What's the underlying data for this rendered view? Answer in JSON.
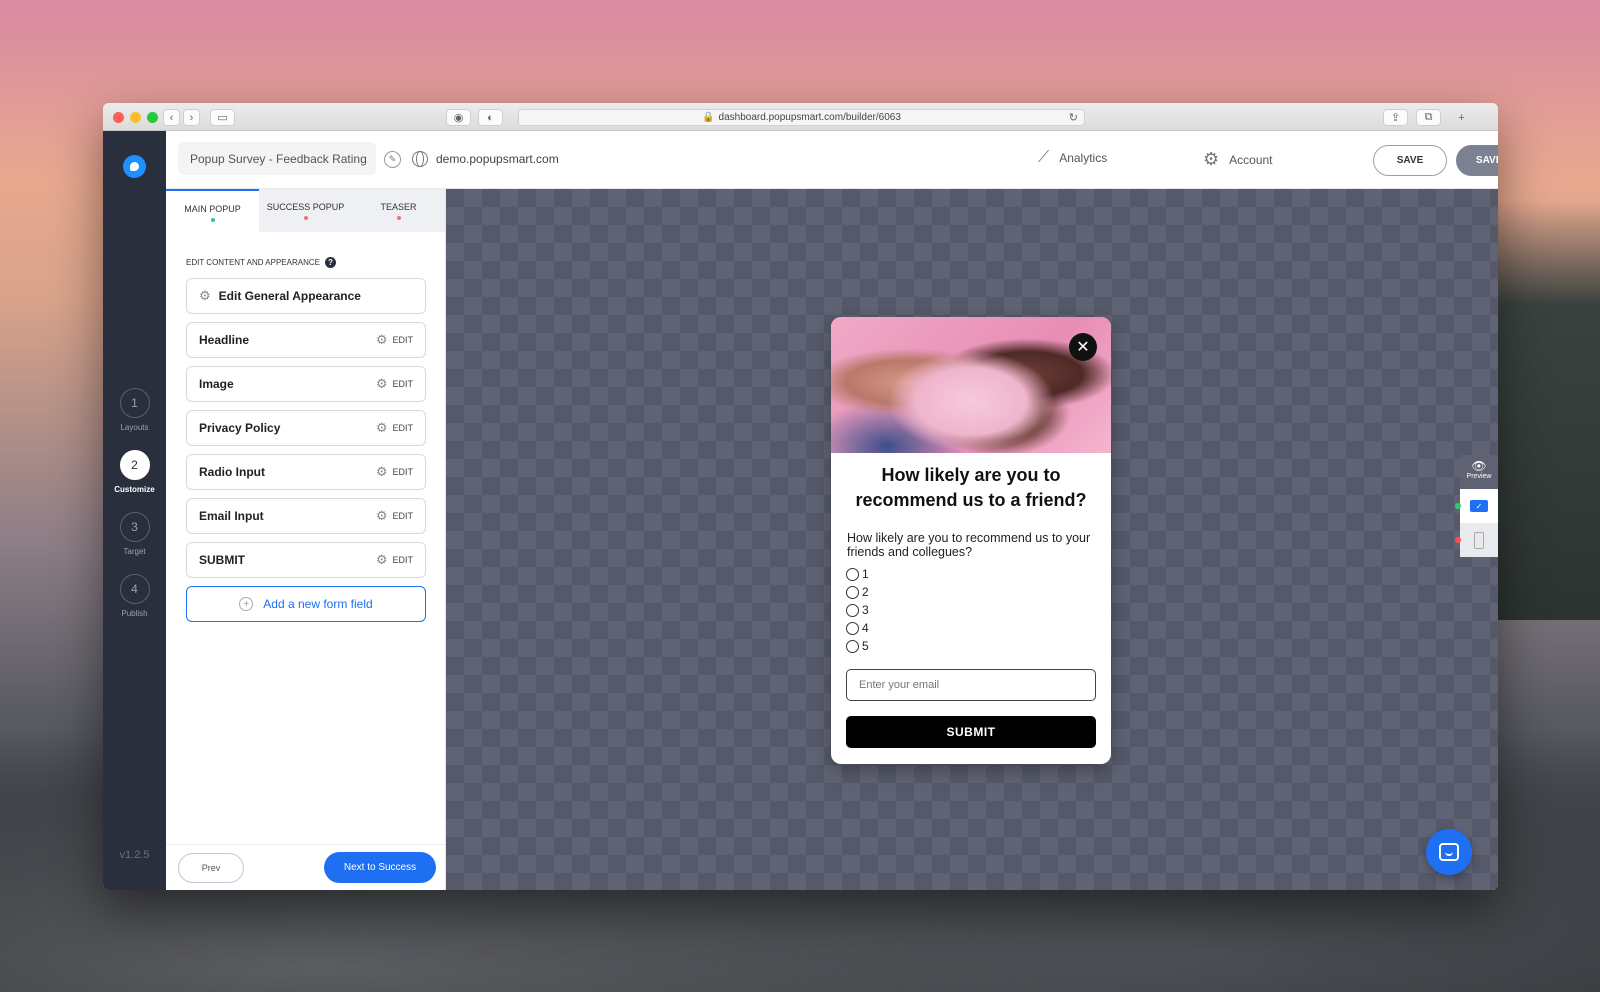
{
  "browser": {
    "url": "dashboard.popupsmart.com/builder/6063"
  },
  "header": {
    "project_name": "Popup Survey - Feedback Rating",
    "domain": "demo.popupsmart.com",
    "analytics_label": "Analytics",
    "account_label": "Account",
    "save_label": "SAVE",
    "publish_label": "SAVE & PUBLISH"
  },
  "leftnav": {
    "steps": [
      {
        "num": "1",
        "label": "Layouts"
      },
      {
        "num": "2",
        "label": "Customize"
      },
      {
        "num": "3",
        "label": "Target"
      },
      {
        "num": "4",
        "label": "Publish"
      }
    ],
    "version": "v1.2.5"
  },
  "panel": {
    "tabs": [
      {
        "label": "MAIN POPUP"
      },
      {
        "label": "SUCCESS POPUP"
      },
      {
        "label": "TEASER"
      }
    ],
    "section_title": "EDIT CONTENT AND APPEARANCE",
    "general": "Edit General Appearance",
    "edit_label": "EDIT",
    "fields": [
      "Headline",
      "Image",
      "Privacy Policy",
      "Radio Input",
      "Email Input",
      "SUBMIT"
    ],
    "add_field": "Add a new form field",
    "prev": "Prev",
    "next": "Next to Success"
  },
  "popup": {
    "title": "How likely are you to recommend us to a friend?",
    "question": "How likely are you to recommend us to your friends and collegues?",
    "options": [
      "1",
      "2",
      "3",
      "4",
      "5"
    ],
    "email_placeholder": "Enter your email",
    "submit": "SUBMIT"
  },
  "side_tools": {
    "preview_label": "Preview"
  },
  "colors": {
    "accent": "#1e6ff2",
    "nav_bg": "#2a2f3d",
    "publish_bg": "#7b8191"
  }
}
